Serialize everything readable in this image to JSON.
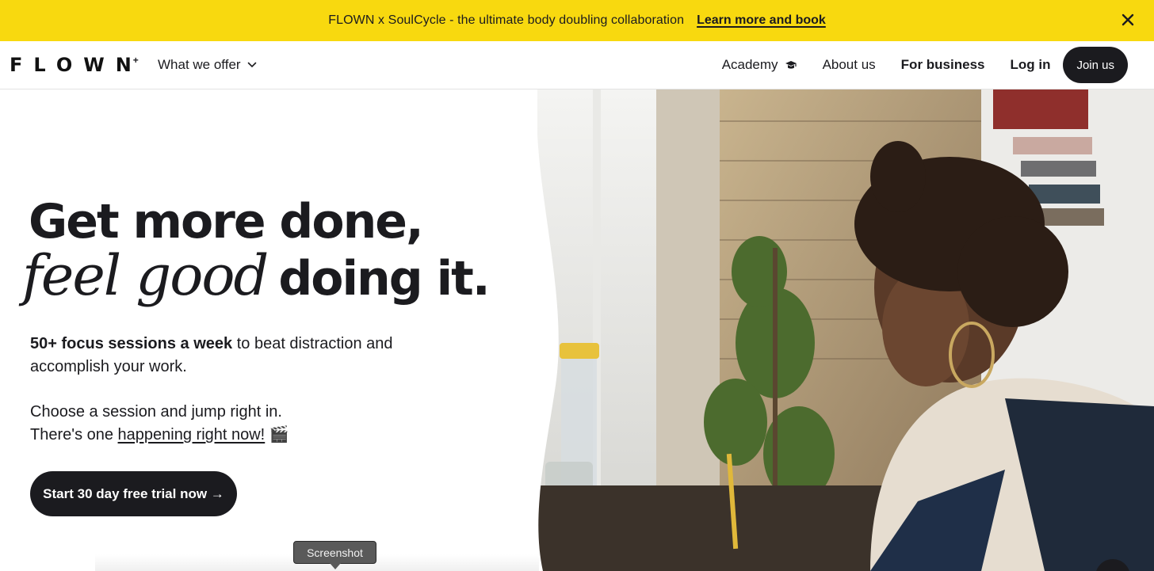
{
  "banner": {
    "text": "FLOWN x SoulCycle - the ultimate body doubling collaboration",
    "link": "Learn more and book"
  },
  "nav": {
    "logo": "FLOWN",
    "offer": "What we offer",
    "academy": "Academy",
    "about": "About us",
    "business": "For business",
    "login": "Log in",
    "join": "Join us"
  },
  "hero": {
    "line1": "Get more done,",
    "italic": "feel good",
    "line2": "doing it.",
    "p1_bold": "50+ focus sessions a week",
    "p1_rest": " to beat distraction and accomplish your work.",
    "p2_line1": "Choose a session and jump right in.",
    "p2_prefix": "There's one ",
    "p2_link": "happening right now!",
    "p2_emoji": "🎬",
    "cta": "Start 30 day free trial now →"
  },
  "tooltip": "Screenshot",
  "colors": {
    "banner": "#f8d90f",
    "dark": "#1b1b1f"
  }
}
